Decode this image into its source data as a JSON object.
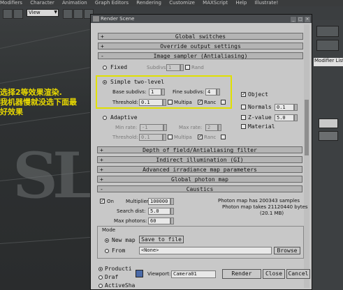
{
  "menubar": {
    "items": [
      "Modifiers",
      "Character",
      "Animation",
      "Graph Editors",
      "Rendering",
      "Customize",
      "MAXScript",
      "Help",
      "Illustrate!"
    ]
  },
  "toolbar": {
    "view_label": "View"
  },
  "viewport": {
    "logo_text": "SL",
    "notes": [
      "选择2等效果渲染.",
      "我机器慢就没选下面最",
      "好效果"
    ]
  },
  "right_panel": {
    "modifier_list_label": "Modifier List"
  },
  "dialog": {
    "title": "Render Scene",
    "rollouts_top": [
      {
        "sign": "+",
        "label": "Global switches"
      },
      {
        "sign": "+",
        "label": "Override output settings"
      },
      {
        "sign": "-",
        "label": "Image sampler (Antialiasing)"
      }
    ],
    "image_sampler": {
      "fixed_label": "Fixed",
      "fixed_subdivs_label": "Subdivs:",
      "fixed_subdivs_value": "1",
      "fixed_rand_label": "Rand",
      "simple_label": "Simple two-level",
      "base_subdivs_label": "Base subdivs:",
      "base_subdivs_value": "1",
      "fine_subdivs_label": "Fine subdivs:",
      "fine_subdivs_value": "4",
      "threshold_label": "Threshold:",
      "threshold_value": "0.1",
      "multipass_label": "Multipa",
      "rand_label": "Ranc",
      "object_label": "Object",
      "normals_label": "Normals",
      "normals_value": "0.1",
      "zvalue_label": "Z-value",
      "zvalue_value": "5.0",
      "material_label": "Material",
      "adaptive_label": "Adaptive",
      "min_rate_label": "Min rate:",
      "min_rate_value": "-1",
      "max_rate_label": "Max rate:",
      "max_rate_value": "2",
      "adaptive_threshold_label": "Threshold:",
      "adaptive_threshold_value": "0.1",
      "adaptive_multipass_label": "Multipa",
      "adaptive_rand_label": "Ranc"
    },
    "rollouts_mid": [
      {
        "sign": "+",
        "label": "Depth of field/Antialiasing filter"
      },
      {
        "sign": "+",
        "label": "Indirect illumination (GI)"
      },
      {
        "sign": "+",
        "label": "Advanced irradiance map parameters"
      },
      {
        "sign": "+",
        "label": "Global photon map"
      },
      {
        "sign": "-",
        "label": "Caustics"
      }
    ],
    "caustics": {
      "on_label": "On",
      "multiplier_label": "Multiplier:",
      "multiplier_value": "100000",
      "search_dist_label": "Search dist:",
      "search_dist_value": "5.0",
      "max_photons_label": "Max photons:",
      "max_photons_value": "60",
      "info_lines": [
        "Photon map has 200343 samples",
        "Photon map takes 21120440 bytes",
        "(20.1 MB)"
      ],
      "mode_label": "Mode",
      "new_map_label": "New map",
      "save_to_file_label": "Save to file",
      "from_label": "From",
      "from_value": "<None>",
      "browse_label": "Browse"
    },
    "bottom": {
      "production_label": "Producti",
      "draft_label": "Draf",
      "activeshade_label": "ActiveSha",
      "viewport_label": "Viewport:",
      "viewport_value": "Camera01",
      "render_label": "Render",
      "close_label": "Close",
      "cancel_label": "Cancel"
    }
  }
}
